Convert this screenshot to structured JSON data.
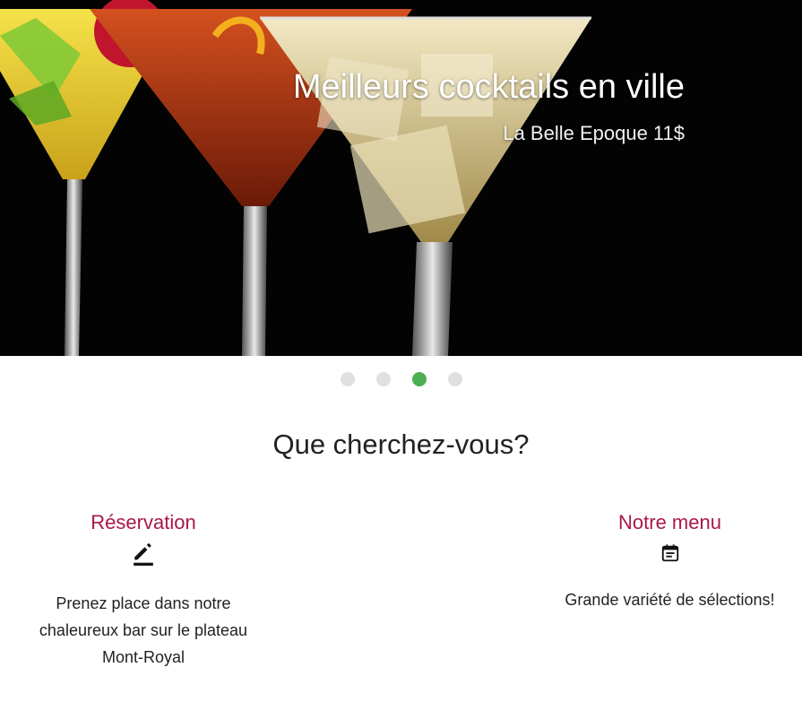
{
  "hero": {
    "title": "Meilleurs cocktails en ville",
    "subtitle": "La Belle Epoque 11$"
  },
  "carousel": {
    "slide_count": 4,
    "active_index": 2,
    "active_color": "#4caf50",
    "inactive_color": "#e0e0e0"
  },
  "section": {
    "title": "Que cherchez-vous?"
  },
  "cards": {
    "reservation": {
      "title": "Réservation",
      "icon": "pencil-edit-icon",
      "text": "Prenez place dans notre chaleureux bar sur le plateau Mont-Royal"
    },
    "menu": {
      "title": "Notre menu",
      "icon": "calendar-note-icon",
      "text": "Grande variété de sélections!"
    }
  },
  "colors": {
    "accent": "#a8184a",
    "hero_background": "#030303"
  }
}
